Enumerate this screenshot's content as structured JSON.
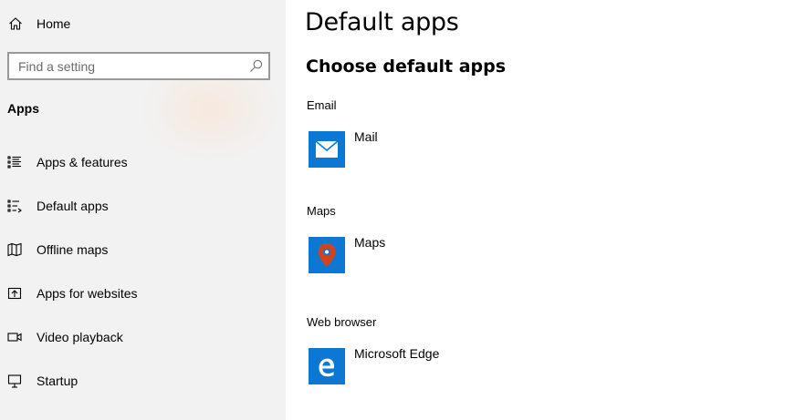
{
  "sidebar": {
    "home_label": "Home",
    "search": {
      "placeholder": "Find a setting"
    },
    "section_title": "Apps",
    "items": [
      {
        "label": "Apps & features",
        "icon": "list-icon"
      },
      {
        "label": "Default apps",
        "icon": "default-apps-icon"
      },
      {
        "label": "Offline maps",
        "icon": "map-icon"
      },
      {
        "label": "Apps for websites",
        "icon": "open-external-icon"
      },
      {
        "label": "Video playback",
        "icon": "video-camera-icon"
      },
      {
        "label": "Startup",
        "icon": "startup-icon"
      }
    ]
  },
  "main": {
    "title": "Default apps",
    "subheading": "Choose default apps",
    "categories": [
      {
        "label": "Email",
        "app": "Mail",
        "icon": "mail-icon"
      },
      {
        "label": "Maps",
        "app": "Maps",
        "icon": "maps-pin-icon"
      },
      {
        "label": "Web browser",
        "app": "Microsoft Edge",
        "icon": "edge-icon"
      }
    ]
  },
  "colors": {
    "sidebar_bg": "#f2f2f2",
    "tile_blue": "#0c78d4",
    "map_pin_red": "#d2421f"
  }
}
